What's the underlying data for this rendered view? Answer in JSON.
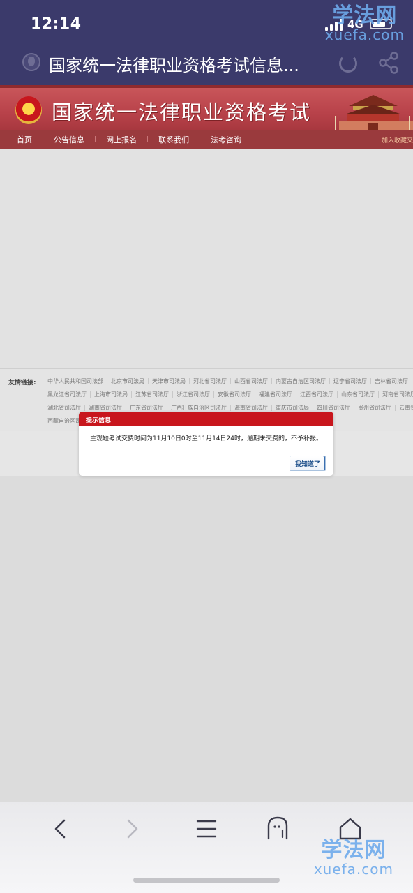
{
  "status_bar": {
    "time": "12:14",
    "network": "4G"
  },
  "watermark": {
    "cn": "学法网",
    "en": "xuefa.com"
  },
  "browser": {
    "page_title": "国家统一法律职业资格考试信息...",
    "icons": [
      "globe-icon",
      "reload-icon",
      "share-icon"
    ]
  },
  "site": {
    "title": "国家统一法律职业资格考试",
    "nav": [
      "首页",
      "公告信息",
      "网上报名",
      "联系我们",
      "法考咨询"
    ],
    "bookmark_link": "加入收藏夹",
    "colors": {
      "header": "#b8424a",
      "nav": "#9a3a3d"
    }
  },
  "friendly_links": {
    "label": "友情链接:",
    "rows": [
      [
        "中华人民共和国司法部",
        "北京市司法局",
        "天津市司法局",
        "河北省司法厅",
        "山西省司法厅",
        "内蒙古自治区司法厅",
        "辽宁省司法厅",
        "吉林省司法厅"
      ],
      [
        "黑龙江省司法厅",
        "上海市司法局",
        "江苏省司法厅",
        "浙江省司法厅",
        "安徽省司法厅",
        "福建省司法厅",
        "江西省司法厅",
        "山东省司法厅",
        "河南省司法厅"
      ],
      [
        "湖北省司法厅",
        "湖南省司法厅",
        "广东省司法厅",
        "广西壮族自治区司法厅",
        "海南省司法厅",
        "重庆市司法局",
        "四川省司法厅",
        "贵州省司法厅",
        "云南省司法厅"
      ],
      [
        "西藏自治区司"
      ]
    ]
  },
  "dialog": {
    "title": "提示信息",
    "message": "主观题考试交费时间为11月10日0时至11月14日24时，逾期未交费的，不予补报。",
    "confirm_label": "我知道了",
    "colors": {
      "header": "#c8161d"
    }
  },
  "toolbar": {
    "icons": [
      "back-icon",
      "forward-icon",
      "menu-icon",
      "tabs-icon",
      "home-icon"
    ]
  }
}
